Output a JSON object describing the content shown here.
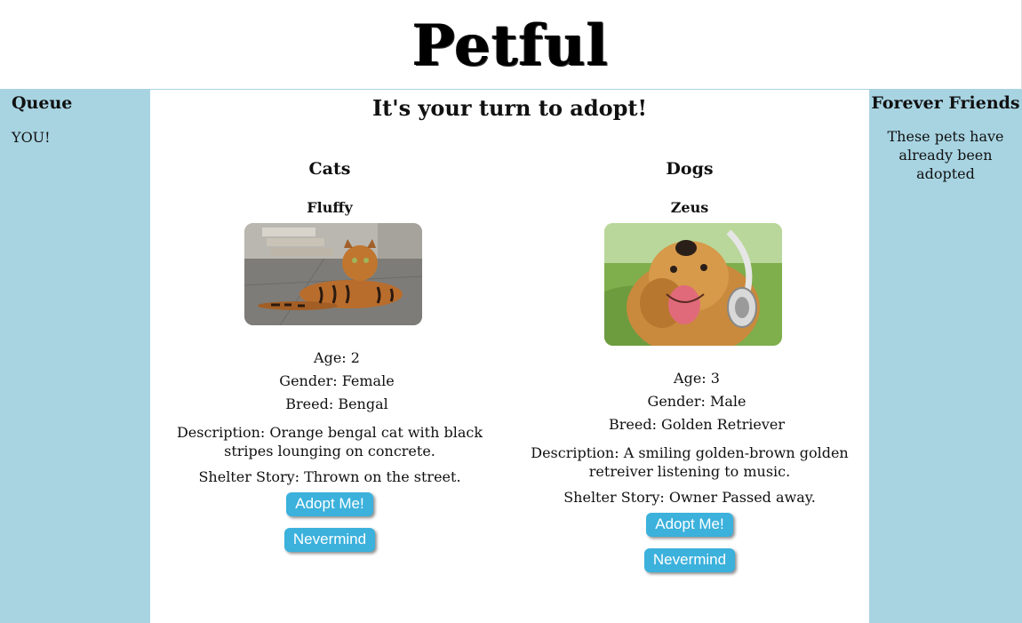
{
  "app": {
    "title": "Petful"
  },
  "queue": {
    "title": "Queue",
    "items": [
      "YOU!"
    ]
  },
  "forever_friends": {
    "title": "Forever Friends",
    "text": "These pets have already been adopted"
  },
  "main": {
    "heading": "It's your turn to adopt!"
  },
  "cats": {
    "section_title": "Cats",
    "name": "Fluffy",
    "age": "Age: 2",
    "gender": "Gender: Female",
    "breed": "Breed: Bengal",
    "description": "Description: Orange bengal cat with black stripes lounging on concrete.",
    "story": "Shelter Story: Thrown on the street.",
    "adopt_label": "Adopt Me!",
    "nevermind_label": "Nevermind"
  },
  "dogs": {
    "section_title": "Dogs",
    "name": "Zeus",
    "age": "Age: 3",
    "gender": "Gender: Male",
    "breed": "Breed: Golden Retriever",
    "description": "Description: A smiling golden-brown golden retreiver listening to music.",
    "story": "Shelter Story: Owner Passed away.",
    "adopt_label": "Adopt Me!",
    "nevermind_label": "Nevermind"
  },
  "colors": {
    "sidebar": "#a8d4e2",
    "button": "#3bb1dc"
  }
}
